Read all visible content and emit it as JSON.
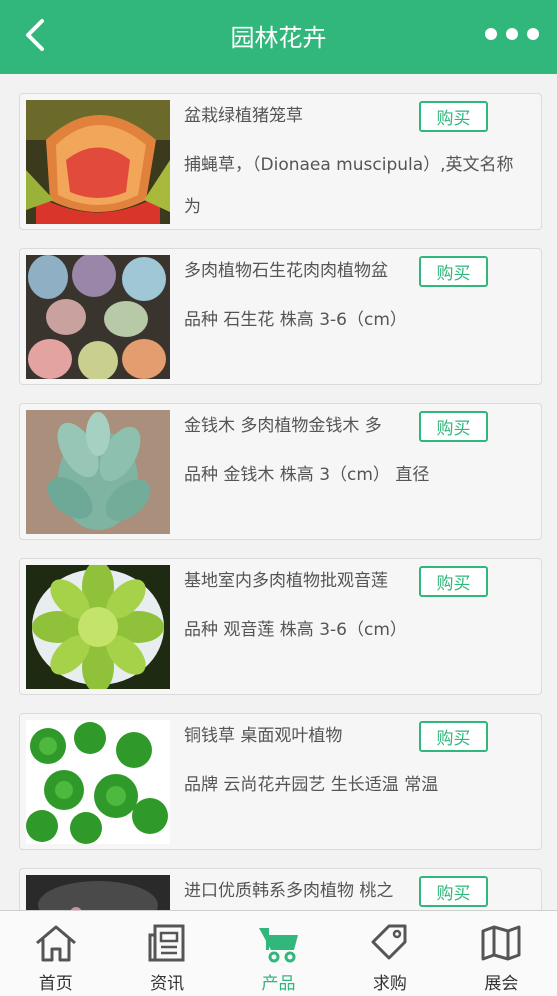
{
  "header": {
    "title": "园林花卉",
    "back_icon": "chevron-left-icon",
    "more_icon": "more-dots-icon",
    "background": "#31b77c"
  },
  "products": [
    {
      "title": "盆栽绿植猪笼草",
      "description": "捕蝇草，（Dionaea muscipula）,英文名称为",
      "buy_label": "购买",
      "image": "venus-flytrap"
    },
    {
      "title": "多肉植物石生花肉肉植物盆",
      "description": "品种 石生花 株高 3-6（cm）",
      "buy_label": "购买",
      "image": "lithops"
    },
    {
      "title": "金钱木 多肉植物金钱木 多",
      "description": "品种 金钱木 株高 3（cm） 直径",
      "buy_label": "购买",
      "image": "jade-plant"
    },
    {
      "title": "基地室内多肉植物批观音莲",
      "description": "品种 观音莲 株高 3-6（cm）",
      "buy_label": "购买",
      "image": "sempervivum"
    },
    {
      "title": "铜钱草 桌面观叶植物",
      "description": "品牌 云尚花卉园艺 生长适温 常温",
      "buy_label": "购买",
      "image": "pennywort"
    },
    {
      "title": "进口优质韩系多肉植物 桃之",
      "description": "",
      "buy_label": "购买",
      "image": "succulent-pot"
    }
  ],
  "tabbar": {
    "items": [
      {
        "label": "首页",
        "icon": "home-icon",
        "active": false
      },
      {
        "label": "资讯",
        "icon": "news-icon",
        "active": false
      },
      {
        "label": "产品",
        "icon": "cart-icon",
        "active": true
      },
      {
        "label": "求购",
        "icon": "tag-icon",
        "active": false
      },
      {
        "label": "展会",
        "icon": "map-icon",
        "active": false
      }
    ],
    "active_color": "#31b77c"
  }
}
